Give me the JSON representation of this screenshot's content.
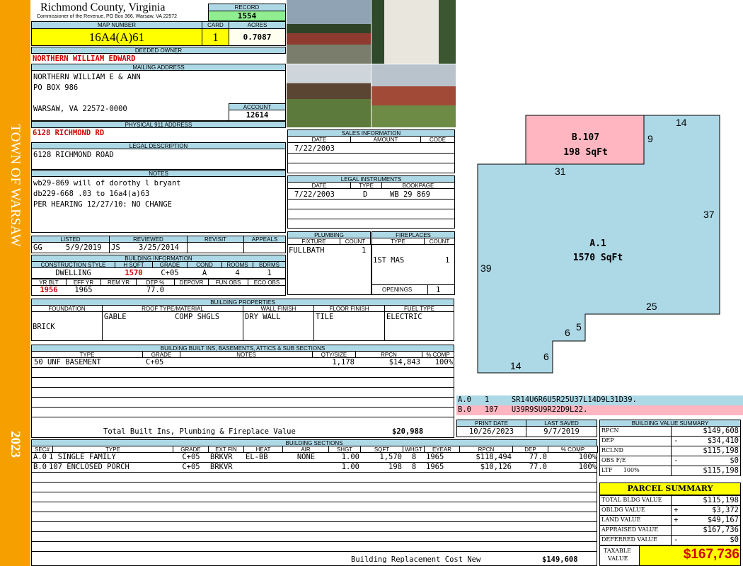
{
  "sidebar": {
    "town": "TOWN OF WARSAW",
    "year": "2023"
  },
  "header": {
    "county": "Richmond County, Virginia",
    "commissioner": "Commissioner of the Revenue, PO Box 366, Warsaw, VA 22572",
    "record_label": "RECORD",
    "record": "1554",
    "map_label": "MAP NUMBER",
    "map_number": "16A4(A)61",
    "card_label": "CARD",
    "card": "1",
    "acres_label": "ACRES",
    "acres": "0.7087"
  },
  "owner": {
    "deeded_label": "DEEDED OWNER",
    "deeded": "NORTHERN WILLIAM EDWARD",
    "mailing_label": "MAILING ADDRESS",
    "line1": "NORTHERN WILLIAM E & ANN",
    "line2": "PO BOX 986",
    "line3": "WARSAW, VA 22572-0000",
    "account_label": "ACCOUNT",
    "account": "12614",
    "physical_label": "PHYSICAL 911 ADDRESS",
    "physical": "6128 RICHMOND RD",
    "legal_label": "LEGAL DESCRIPTION",
    "legal": "6128 RICHMOND ROAD",
    "notes_label": "NOTES",
    "note1": "wb29-869 will of dorothy l bryant",
    "note2": "db229-668 .03 to 16a4(a)63",
    "note3": "PER HEARING 12/27/10: NO CHANGE"
  },
  "listing": {
    "listed_label": "LISTED",
    "listed_by": "GG",
    "listed_date": "5/9/2019",
    "reviewed_label": "REVIEWED",
    "reviewed_by": "JS",
    "reviewed_date": "3/25/2014",
    "revisit_label": "REVISIT",
    "appeals_label": "APPEALS"
  },
  "building_info": {
    "label": "BUILDING INFORMATION",
    "h_style": "CONSTRUCTION STYLE",
    "h_sqft": "H SQFT",
    "h_grade": "GRADE",
    "h_cond": "COND",
    "h_rooms": "ROOMS",
    "h_bdrms": "BDRMS",
    "style": "DWELLING",
    "sqft": "1570",
    "grade": "C+05",
    "cond": "A",
    "rooms": "4",
    "bdrms": "1",
    "h_yrblt": "YR BLT",
    "h_effyr": "EFF YR",
    "h_remyr": "REM YR",
    "h_dep": "DEP %",
    "h_depovr": "DEPOVR",
    "h_funobs": "FUN OBS",
    "h_ecoobs": "ECO OBS",
    "yrblt": "1956",
    "effyr": "1965",
    "dep": "77.0"
  },
  "sales": {
    "label": "SALES INFORMATION",
    "h_date": "DATE",
    "h_amount": "AMOUNT",
    "h_code": "CODE",
    "date": "7/22/2003"
  },
  "legal_instruments": {
    "label": "LEGAL INSTRUMENTS",
    "h_date": "DATE",
    "h_type": "TYPE",
    "h_book": "BOOKPAGE",
    "date": "7/22/2003",
    "type": "D",
    "book": "WB 29 869"
  },
  "plumbing": {
    "label": "PLUMBING",
    "h_fixture": "FIXTURE",
    "h_count": "COUNT",
    "fixture": "FULLBATH",
    "count": "1"
  },
  "fireplaces": {
    "label": "FIREPLACES",
    "h_type": "TYPE",
    "h_count": "COUNT",
    "type": "1ST MAS",
    "count": "1",
    "openings_label": "OPENINGS",
    "openings": "1"
  },
  "properties": {
    "label": "BUILDING PROPERTIES",
    "h_foundation": "FOUNDATION",
    "h_roof": "ROOF TYPE/MATERIAL",
    "h_wall": "WALL FINISH",
    "h_floor": "FLOOR FINISH",
    "h_fuel": "FUEL TYPE",
    "foundation": "BRICK",
    "roof_type": "GABLE",
    "roof_mat": "COMP SHGLS",
    "wall": "DRY WALL",
    "floor": "TILE",
    "fuel": "ELECTRIC"
  },
  "builtins": {
    "label": "BUILDING BUILT INS, BASEMENTS, ATTICS & SUB SECTIONS",
    "h_type": "TYPE",
    "h_grade": "GRADE",
    "h_notes": "NOTES",
    "h_qty": "QTY/SIZE",
    "h_rpcn": "RPCN",
    "h_comp": "% COMP",
    "row_type": "50 UNF BASEMENT",
    "row_grade": "C+05",
    "row_qty": "1,178",
    "row_rpcn": "$14,843",
    "row_comp": "100%",
    "total_label": "Total Built Ins, Plumbing & Fireplace Value",
    "total": "$20,988"
  },
  "sections": {
    "label": "BUILDING SECTIONS",
    "h": [
      "SEC#",
      "TYPE",
      "GRADE",
      "EXT FIN",
      "HEAT",
      "AIR",
      "SHGT",
      "SQFT",
      "WHGT",
      "EYEAR",
      "RPCN",
      "DEP",
      "% COMP"
    ],
    "rows": [
      [
        "A.0",
        "1 SINGLE FAMILY",
        "C+05",
        "BRKVR",
        "EL-BB",
        "NONE",
        "1.00",
        "1,570",
        "8",
        "1965",
        "$118,494",
        "77.0",
        "100%"
      ],
      [
        "B.0",
        "107 ENCLOSED PORCH",
        "C+05",
        "BRKVR",
        "",
        "",
        "1.00",
        "198",
        "8",
        "1965",
        "$10,126",
        "77.0",
        "100%"
      ]
    ],
    "rcn_label": "Building Replacement Cost New",
    "rcn": "$149,608"
  },
  "sketch": {
    "a_label": "A.1",
    "a_sqft": "1570 SqFt",
    "b_label": "B.107",
    "b_sqft": "198 SqFt",
    "dims": [
      "14",
      "9",
      "31",
      "37",
      "39",
      "25",
      "5",
      "6",
      "6",
      "14"
    ],
    "code_a": "A.0   1     SR14U6R6U5R25U37L14D9L31D39.",
    "code_b": "B.0   107   U39R9SU9R22D9L22."
  },
  "dates": {
    "print_label": "PRINT DATE",
    "print": "10/26/2023",
    "saved_label": "LAST SAVED",
    "saved": "9/7/2019"
  },
  "value_summary": {
    "label": "BUILDING VALUE SUMMARY",
    "rows": [
      [
        "RPCN",
        "",
        "$149,608"
      ],
      [
        "DEP",
        "-",
        "$34,410"
      ],
      [
        "RCLND",
        "",
        "$115,198"
      ],
      [
        "OBS F/E",
        "-",
        "$0"
      ],
      [
        "LTF      100%",
        "",
        "$115,198"
      ]
    ]
  },
  "parcel": {
    "label": "PARCEL SUMMARY",
    "rows": [
      [
        "TOTAL BLDG VALUE",
        "",
        "$115,198"
      ],
      [
        "OBLDG VALUE",
        "+",
        "$3,372"
      ],
      [
        "LAND VALUE",
        "+",
        "$49,167"
      ],
      [
        "APPRAISED VALUE",
        "",
        "$167,736"
      ],
      [
        "DEFERRED VALUE",
        "-",
        "$0"
      ]
    ],
    "taxable_label1": "TAXABLE",
    "taxable_label2": "VALUE",
    "taxable": "$167,736"
  },
  "photos": [
    "front-house-photo",
    "shed-photo",
    "carport-photo",
    "rear-house-photo"
  ],
  "colors": {
    "orange": "#f5a000",
    "blue": "#add8e6",
    "yellow": "#ffff00",
    "green": "#90ee90",
    "pink": "#ffb6c1",
    "red": "#d00000"
  }
}
